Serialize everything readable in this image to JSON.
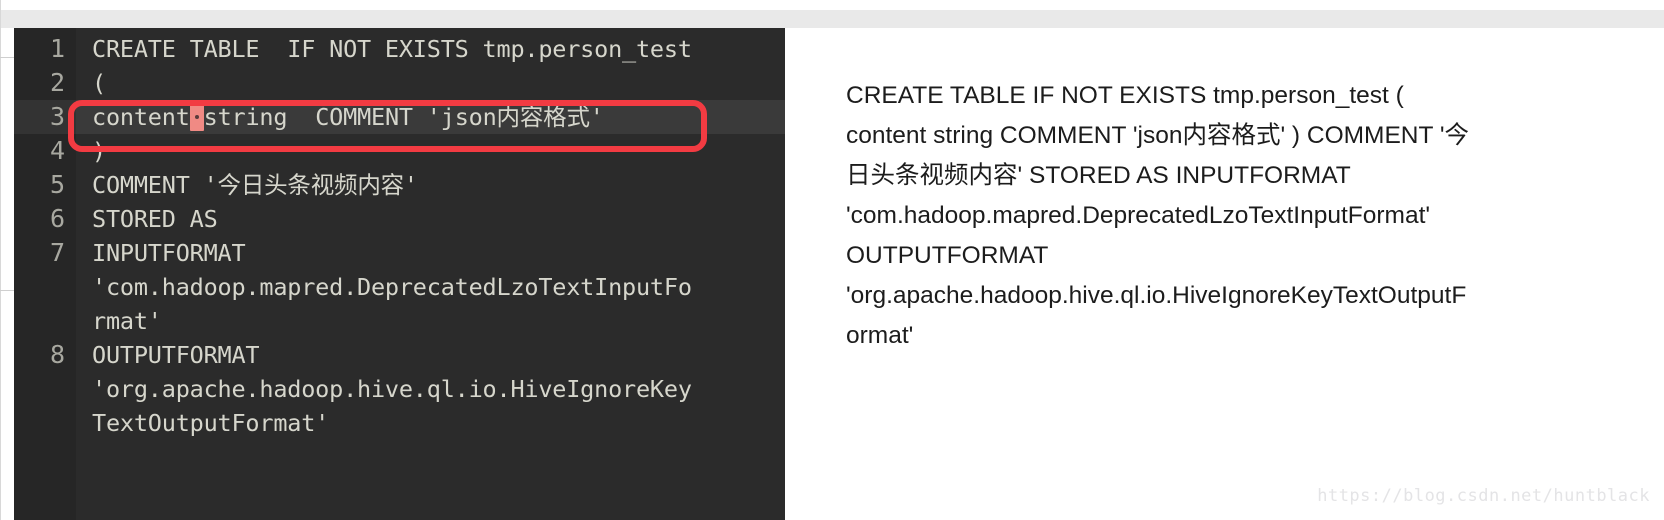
{
  "colors": {
    "page_background": "#ffffff",
    "top_band": "#e9e9e9",
    "editor_background": "#2b2b2b",
    "editor_gutter": "#262626",
    "editor_active_line": "#3a3a3a",
    "editor_text": "#d6d6cc",
    "editor_line_number": "#a8a8a0",
    "annotation_red": "#f23b42",
    "whitespace_marker": "#f08a84",
    "right_panel_background": "#ffffff",
    "right_panel_text": "#1c1c1c",
    "watermark": "#e4e4e6"
  },
  "editor": {
    "lines": [
      {
        "number": "1",
        "segments": [
          {
            "text": "CREATE TABLE  IF NOT EXISTS tmp.person_test"
          }
        ],
        "highlighted": false
      },
      {
        "number": "2",
        "segments": [
          {
            "text": "("
          }
        ],
        "highlighted": false
      },
      {
        "number": "3",
        "segments": [
          {
            "text": "content"
          },
          {
            "whitespace_marker": true
          },
          {
            "text": "string  COMMENT 'json内容格式'"
          }
        ],
        "highlighted": true
      },
      {
        "number": "4",
        "segments": [
          {
            "text": ")"
          }
        ],
        "highlighted": false
      },
      {
        "number": "5",
        "segments": [
          {
            "text": "COMMENT '今日头条视频内容'"
          }
        ],
        "highlighted": false
      },
      {
        "number": "6",
        "segments": [
          {
            "text": "STORED AS"
          }
        ],
        "highlighted": false
      },
      {
        "number": "7",
        "segments": [
          {
            "text": "INPUTFORMAT"
          },
          {
            "text": "'com.hadoop.mapred.DeprecatedLzoTextInputFo",
            "wrapped": true
          },
          {
            "text": "rmat'",
            "wrapped": true
          }
        ],
        "highlighted": false
      },
      {
        "number": "8",
        "segments": [
          {
            "text": "OUTPUTFORMAT"
          },
          {
            "text": "'org.apache.hadoop.hive.ql.io.HiveIgnoreKey",
            "wrapped": true
          },
          {
            "text": "TextOutputFormat'",
            "wrapped": true
          }
        ],
        "highlighted": false
      }
    ]
  },
  "right_panel": {
    "lines": [
      "CREATE TABLE IF NOT EXISTS tmp.person_test (",
      "content string COMMENT 'json内容格式' ) COMMENT '今",
      "日头条视频内容' STORED AS INPUTFORMAT",
      "'com.hadoop.mapred.DeprecatedLzoTextInputFormat'",
      "OUTPUTFORMAT",
      "'org.apache.hadoop.hive.ql.io.HiveIgnoreKeyTextOutputF",
      "ormat'"
    ],
    "full_text": "CREATE TABLE IF NOT EXISTS tmp.person_test ( content string COMMENT 'json内容格式' ) COMMENT '今日头条视频内容' STORED AS INPUTFORMAT 'com.hadoop.mapred.DeprecatedLzoTextInputFormat' OUTPUTFORMAT 'org.apache.hadoop.hive.ql.io.HiveIgnoreKeyTextOutputFormat'"
  },
  "watermark": {
    "text": "https://blog.csdn.net/huntblack"
  }
}
